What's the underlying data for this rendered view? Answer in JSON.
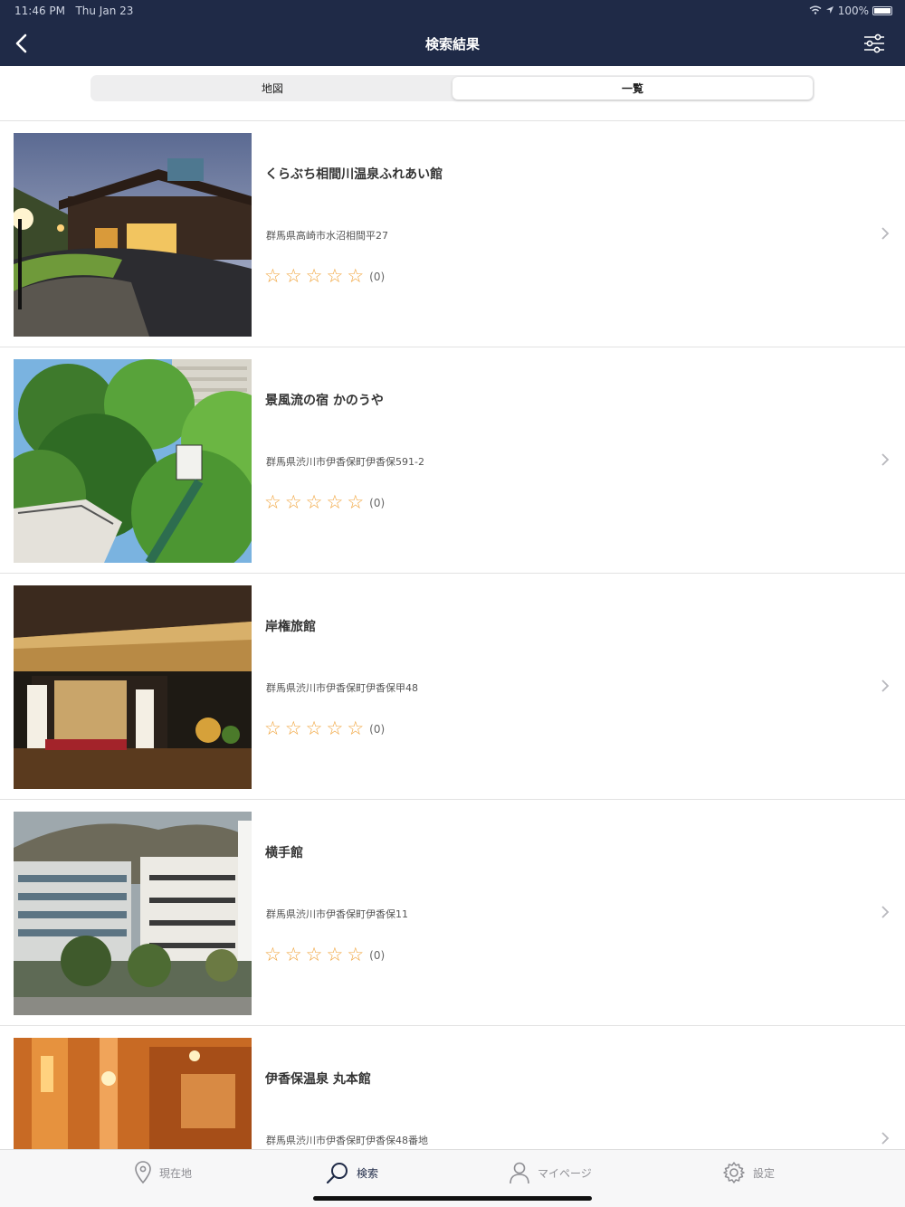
{
  "status": {
    "time": "11:46 PM",
    "date": "Thu Jan 23",
    "battery": "100%"
  },
  "nav": {
    "title": "検索結果"
  },
  "segments": {
    "map": "地図",
    "list": "一覧"
  },
  "results": [
    {
      "name": "くらぶち相間川温泉ふれあい館",
      "address": "群馬県高崎市水沼相間平27",
      "rating_count": "(0)",
      "stars": 0
    },
    {
      "name": "景風流の宿 かのうや",
      "address": "群馬県渋川市伊香保町伊香保591-2",
      "rating_count": "(0)",
      "stars": 0
    },
    {
      "name": "岸権旅館",
      "address": "群馬県渋川市伊香保町伊香保甲48",
      "rating_count": "(0)",
      "stars": 0
    },
    {
      "name": "横手館",
      "address": "群馬県渋川市伊香保町伊香保11",
      "rating_count": "(0)",
      "stars": 0
    },
    {
      "name": "伊香保温泉 丸本館",
      "address": "群馬県渋川市伊香保町伊香保48番地",
      "rating_count": "",
      "stars": 0
    }
  ],
  "tabs": {
    "location": "現在地",
    "search": "検索",
    "mypage": "マイページ",
    "settings": "設定"
  },
  "colors": {
    "navbar": "#1f2a47",
    "star": "#f0a33a"
  }
}
